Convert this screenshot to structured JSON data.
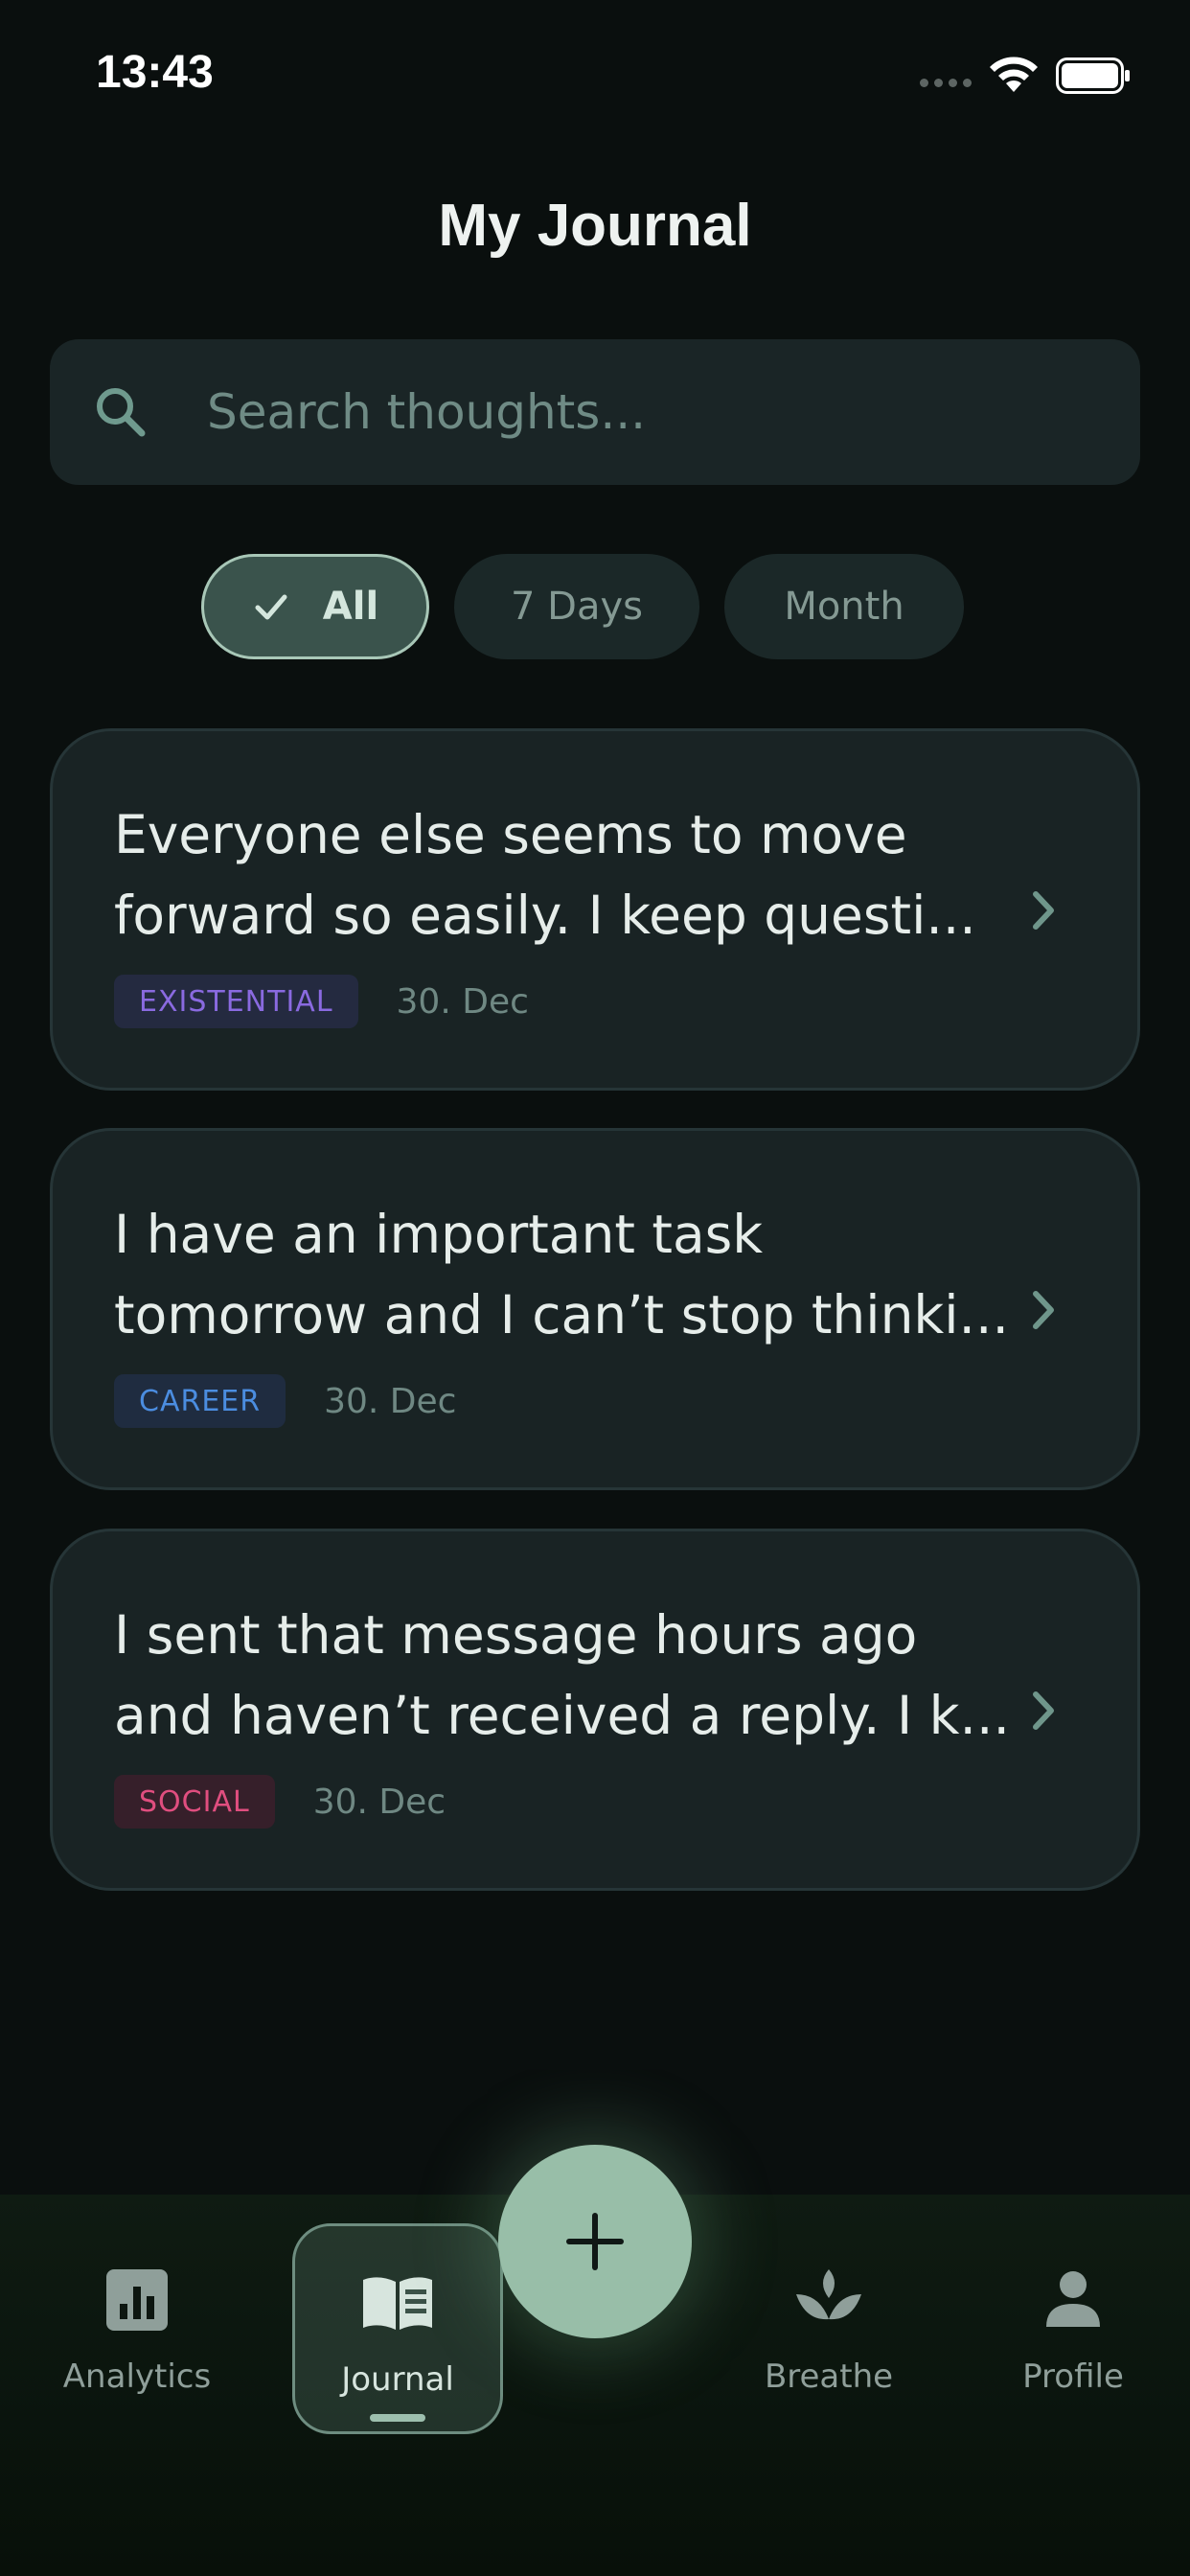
{
  "status_bar": {
    "time": "13:43"
  },
  "header": {
    "title": "My Journal"
  },
  "search": {
    "placeholder": "Search thoughts..."
  },
  "filters": [
    {
      "label": "All",
      "active": true
    },
    {
      "label": "7 Days",
      "active": false
    },
    {
      "label": "Month",
      "active": false
    }
  ],
  "entries": [
    {
      "line1": "Everyone else seems to move",
      "line2": "forward so easily. I keep questi...",
      "tag": "EXISTENTIAL",
      "date": "30. Dec"
    },
    {
      "line1": "I have an important task",
      "line2": "tomorrow and I can’t stop thinki...",
      "tag": "CAREER",
      "date": "30. Dec"
    },
    {
      "line1": "I sent that message hours ago",
      "line2": "and haven’t received a reply. I k...",
      "tag": "SOCIAL",
      "date": "30. Dec"
    }
  ],
  "nav": {
    "items": [
      {
        "label": "Analytics",
        "icon": "bar-chart-icon"
      },
      {
        "label": "Journal",
        "icon": "book-icon",
        "active": true
      },
      {
        "label": "Breathe",
        "icon": "lotus-icon"
      },
      {
        "label": "Profile",
        "icon": "person-icon"
      }
    ],
    "fab_icon": "plus-icon"
  },
  "colors": {
    "background": "#0a0f0e",
    "card": "#192324",
    "accent": "#98bea8",
    "tag_existential": "#8a6ae0",
    "tag_career": "#4b8de0",
    "tag_social": "#e04e7f"
  }
}
